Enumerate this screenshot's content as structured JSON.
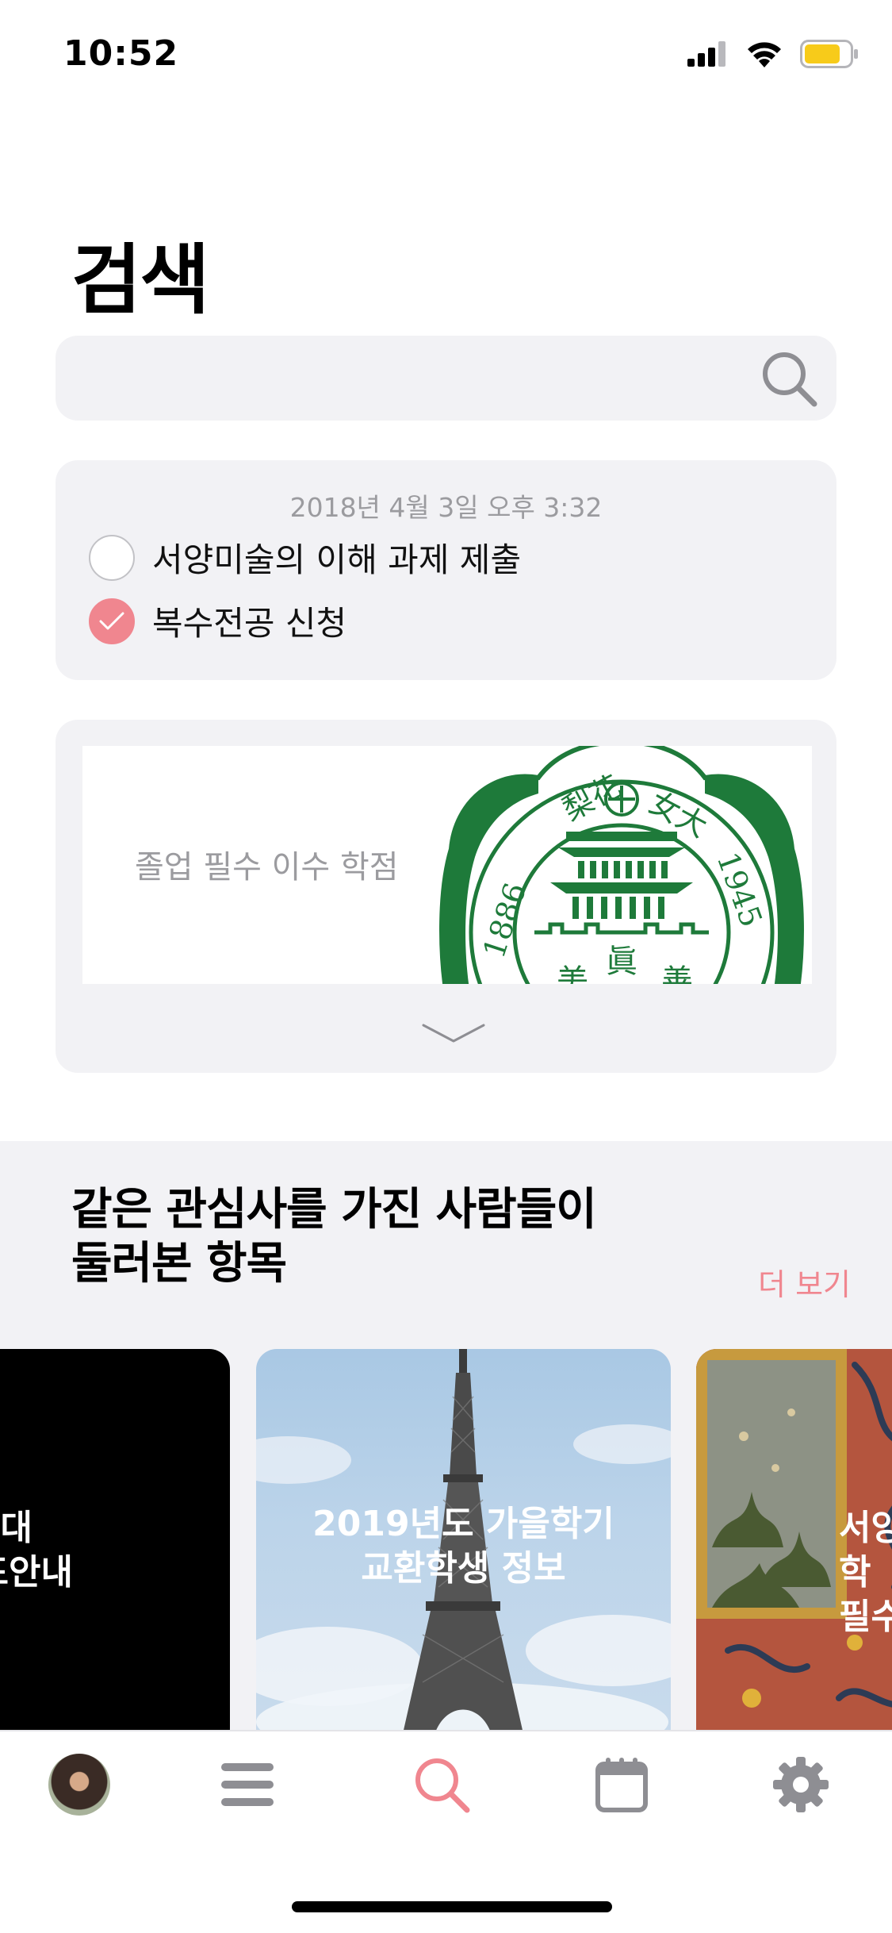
{
  "status_bar": {
    "time": "10:52"
  },
  "title": "검색",
  "search": {
    "placeholder": "",
    "value": ""
  },
  "memo": {
    "date": "2018년 4월 3일 오후 3:32",
    "items": [
      {
        "label": "서양미술의 이해 과제 제출",
        "checked": false
      },
      {
        "label": "복수전공 신청",
        "checked": true
      }
    ]
  },
  "banner": {
    "text": "졸업 필수 이수 학점",
    "seal_text": {
      "years": "1886 梨花 女大 1945",
      "bottom_left": "美",
      "bottom_center": "眞",
      "bottom_right": "善"
    }
  },
  "recommendations": {
    "title_line1": "같은 관심사를 가진 사람들이",
    "title_line2": "둘러본 항목",
    "more": "더 보기",
    "cards": [
      {
        "label": "E예대\n투표안내"
      },
      {
        "label": "2019년도 가을학기\n교환학생 정보"
      },
      {
        "label": "서양\n학\n필수"
      }
    ]
  },
  "colors": {
    "accent": "#f0868f",
    "card_bg": "#f2f2f5",
    "seal_green": "#1e7a3a"
  },
  "tabs": [
    "profile-tab",
    "menu-tab",
    "search-tab",
    "calendar-tab",
    "settings-tab"
  ]
}
